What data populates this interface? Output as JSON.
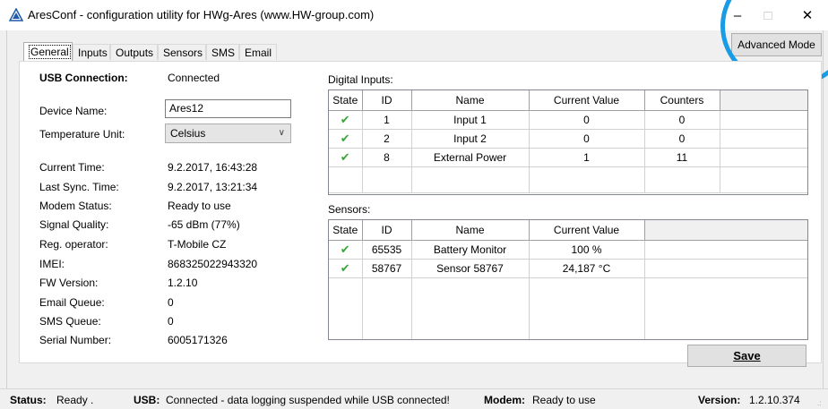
{
  "window": {
    "title": "AresConf - configuration utility for HWg-Ares (www.HW-group.com)",
    "icon": "ares-warning-triangle-icon"
  },
  "advanced_mode_label": "Advanced Mode",
  "tabs": [
    {
      "label": "General",
      "active": true
    },
    {
      "label": "Inputs"
    },
    {
      "label": "Outputs"
    },
    {
      "label": "Sensors"
    },
    {
      "label": "SMS"
    },
    {
      "label": "Email"
    }
  ],
  "general": {
    "usb_connection_label": "USB Connection:",
    "usb_connection_value": "Connected",
    "device_name_label": "Device Name:",
    "device_name_value": "Ares12",
    "temperature_unit_label": "Temperature Unit:",
    "temperature_unit_value": "Celsius",
    "info": [
      {
        "label": "Current Time:",
        "value": "9.2.2017, 16:43:28"
      },
      {
        "label": "Last Sync. Time:",
        "value": "9.2.2017, 13:21:34"
      },
      {
        "label": "Modem Status:",
        "value": "Ready to use"
      },
      {
        "label": "Signal Quality:",
        "value": "-65 dBm (77%)"
      },
      {
        "label": "Reg. operator:",
        "value": "T-Mobile CZ"
      },
      {
        "label": "IMEI:",
        "value": "868325022943320"
      },
      {
        "label": "FW Version:",
        "value": "1.2.10"
      },
      {
        "label": "Email Queue:",
        "value": "0"
      },
      {
        "label": "SMS Queue:",
        "value": "0"
      },
      {
        "label": "Serial Number:",
        "value": "6005171326"
      }
    ]
  },
  "digital_inputs": {
    "caption": "Digital Inputs:",
    "columns": [
      "State",
      "ID",
      "Name",
      "Current Value",
      "Counters"
    ],
    "rows": [
      {
        "id": "1",
        "name": "Input 1",
        "value": "0",
        "counter": "0"
      },
      {
        "id": "2",
        "name": "Input 2",
        "value": "0",
        "counter": "0"
      },
      {
        "id": "8",
        "name": "External Power",
        "value": "1",
        "counter": "11"
      }
    ]
  },
  "sensors": {
    "caption": "Sensors:",
    "columns": [
      "State",
      "ID",
      "Name",
      "Current Value"
    ],
    "rows": [
      {
        "id": "65535",
        "name": "Battery Monitor",
        "value": "100 %"
      },
      {
        "id": "58767",
        "name": "Sensor 58767",
        "value": "24,187 °C"
      }
    ]
  },
  "save_label": "Save",
  "status": {
    "status_label": "Status:",
    "status_value": "Ready .",
    "usb_label": "USB:",
    "usb_value": "Connected - data logging suspended while USB connected!",
    "modem_label": "Modem:",
    "modem_value": "Ready to use",
    "version_label": "Version:",
    "version_value": "1.2.10.374"
  },
  "colors": {
    "highlight_circle": "#1a9be6",
    "check_green": "#3aa53a"
  }
}
